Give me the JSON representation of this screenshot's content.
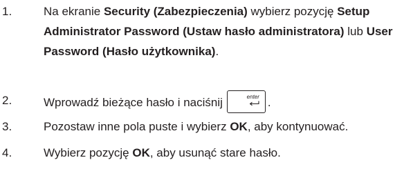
{
  "steps": [
    {
      "number": "1.",
      "parts": [
        "Na ekranie ",
        "Security (Zabezpieczenia)",
        " wybierz pozycję ",
        "Setup Administrator Password (Ustaw hasło administratora)",
        " lub ",
        "User Password (Hasło użytkownika)",
        "."
      ]
    },
    {
      "number": "2.",
      "before_key": "Wprowadź bieżące hasło i naciśnij",
      "key_label": "enter",
      "key_icon": "enter-arrow-icon",
      "after_key": "."
    },
    {
      "number": "3.",
      "parts": [
        "Pozostaw inne pola puste i wybierz ",
        "OK",
        ", aby kontynuować."
      ]
    },
    {
      "number": "4.",
      "parts": [
        "Wybierz pozycję ",
        "OK",
        ", aby usunąć stare hasło."
      ]
    }
  ]
}
